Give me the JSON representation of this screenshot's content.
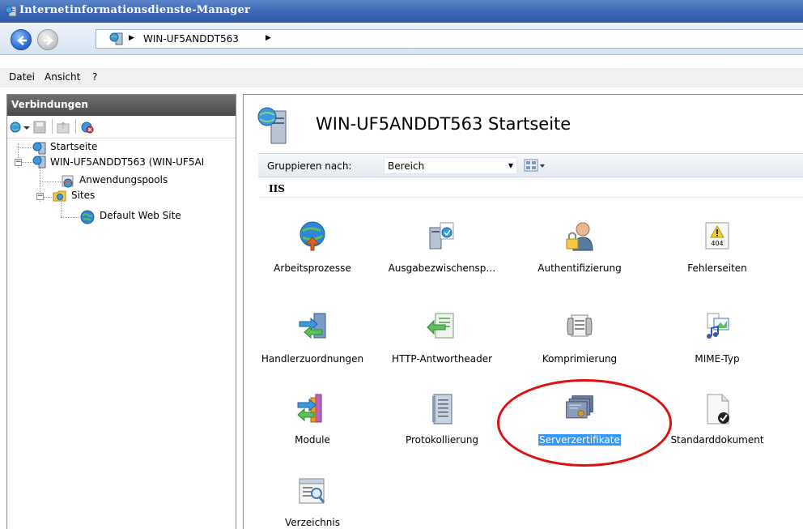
{
  "window": {
    "title": "Internetinformationsdienste-Manager"
  },
  "addressbar": {
    "crumb": "WIN-UF5ANDDT563",
    "separator": "▶"
  },
  "menu": {
    "items": [
      "Datei",
      "Ansicht",
      "?"
    ]
  },
  "connections": {
    "header": "Verbindungen",
    "tree": [
      {
        "label": "Startseite",
        "level": 1
      },
      {
        "label": "WIN-UF5ANDDT563 (WIN-UF5AI",
        "level": 1,
        "expanded": true
      },
      {
        "label": "Anwendungspools",
        "level": 2
      },
      {
        "label": "Sites",
        "level": 2,
        "expanded": true
      },
      {
        "label": "Default Web Site",
        "level": 3
      }
    ]
  },
  "main": {
    "title": "WIN-UF5ANDDT563 Startseite",
    "group_by_label": "Gruppieren nach:",
    "group_by_value": "Bereich",
    "section": "IIS",
    "features": [
      {
        "label": "Arbeitsprozesse",
        "icon": "worker-process-icon"
      },
      {
        "label": "Ausgabezwischensp…",
        "icon": "output-cache-icon"
      },
      {
        "label": "Authentifizierung",
        "icon": "authentication-icon"
      },
      {
        "label": "Fehlerseiten",
        "icon": "error-pages-icon"
      },
      {
        "label": "Handlerzuordnungen",
        "icon": "handler-mappings-icon"
      },
      {
        "label": "HTTP-Antwortheader",
        "icon": "http-headers-icon"
      },
      {
        "label": "Komprimierung",
        "icon": "compression-icon"
      },
      {
        "label": "MIME-Typ",
        "icon": "mime-types-icon"
      },
      {
        "label": "Module",
        "icon": "modules-icon"
      },
      {
        "label": "Protokollierung",
        "icon": "logging-icon"
      },
      {
        "label": "Serverzertifikate",
        "icon": "server-certificates-icon",
        "selected": true
      },
      {
        "label": "Standarddokument",
        "icon": "default-document-icon"
      },
      {
        "label": "Verzeichnis",
        "icon": "directory-browsing-icon"
      }
    ],
    "error_icon_text": "404"
  },
  "colors": {
    "titlebar": "#3a67b5",
    "selection": "#3399ff",
    "highlight_ring": "#e01010"
  }
}
